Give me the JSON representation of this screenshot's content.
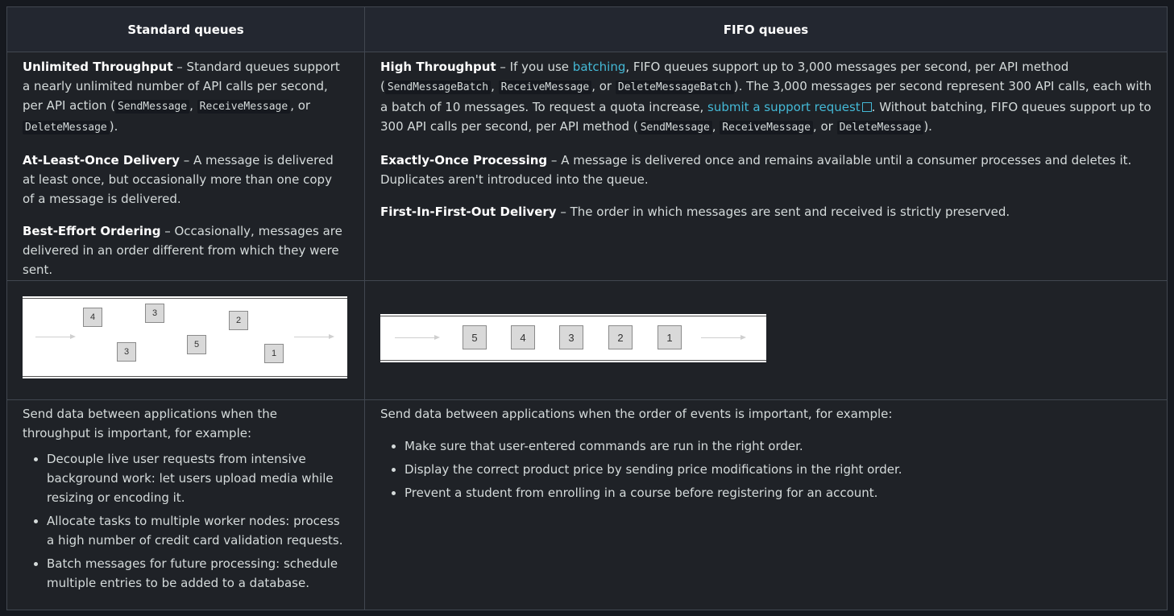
{
  "headers": {
    "standard": "Standard queues",
    "fifo": "FIFO queues"
  },
  "standard": {
    "throughput_title": "Unlimited Throughput",
    "throughput_text": " – Standard queues support a nearly unlimited number of API calls per second, per API action (",
    "code_send": "SendMessage",
    "code_receive": "ReceiveMessage",
    "code_delete": "DeleteMessage",
    "sep1": ", ",
    "sep_or": ", or ",
    "end": ").",
    "delivery_title": "At-Least-Once Delivery",
    "delivery_text": " – A message is delivered at least once, but occasionally more than one copy of a message is delivered.",
    "ordering_title": "Best-Effort Ordering",
    "ordering_text": " – Occasionally, messages are delivered in an order different from which they were sent.",
    "diagram_boxes": [
      "4",
      "3",
      "2",
      "3",
      "5",
      "1"
    ],
    "use_intro": "Send data between applications when the throughput is important, for example:",
    "use_items": [
      "Decouple live user requests from intensive background work: let users upload media while resizing or encoding it.",
      "Allocate tasks to multiple worker nodes: process a high number of credit card validation requests.",
      "Batch messages for future processing: schedule multiple entries to be added to a database."
    ]
  },
  "fifo": {
    "throughput_title": "High Throughput",
    "t1": " – If you use ",
    "batching_link": "batching",
    "t2": ", FIFO queues support up to 3,000 messages per second, per API method (",
    "code_send_batch": "SendMessageBatch",
    "code_receive": "ReceiveMessage",
    "code_delete_batch": "DeleteMessageBatch",
    "t3": "). The 3,000 messages per second represent 300 API calls, each with a batch of 10 messages. To request a quota increase, ",
    "support_link": "submit a support request",
    "t4": ". Without batching, FIFO queues support up to 300 API calls per second, per API method (",
    "code_send": "SendMessage",
    "code_delete": "DeleteMessage",
    "sep1": ", ",
    "sep_or": ", or ",
    "end": ").",
    "processing_title": "Exactly-Once Processing",
    "processing_text": " – A message is delivered once and remains available until a consumer processes and deletes it. Duplicates aren't introduced into the queue.",
    "delivery_title": "First-In-First-Out Delivery",
    "delivery_text": " – The order in which messages are sent and received is strictly preserved.",
    "diagram_boxes": [
      "5",
      "4",
      "3",
      "2",
      "1"
    ],
    "use_intro": "Send data between applications when the order of events is important, for example:",
    "use_items": [
      "Make sure that user-entered commands are run in the right order.",
      "Display the correct product price by sending price modifications in the right order.",
      "Prevent a student from enrolling in a course before registering for an account."
    ]
  }
}
